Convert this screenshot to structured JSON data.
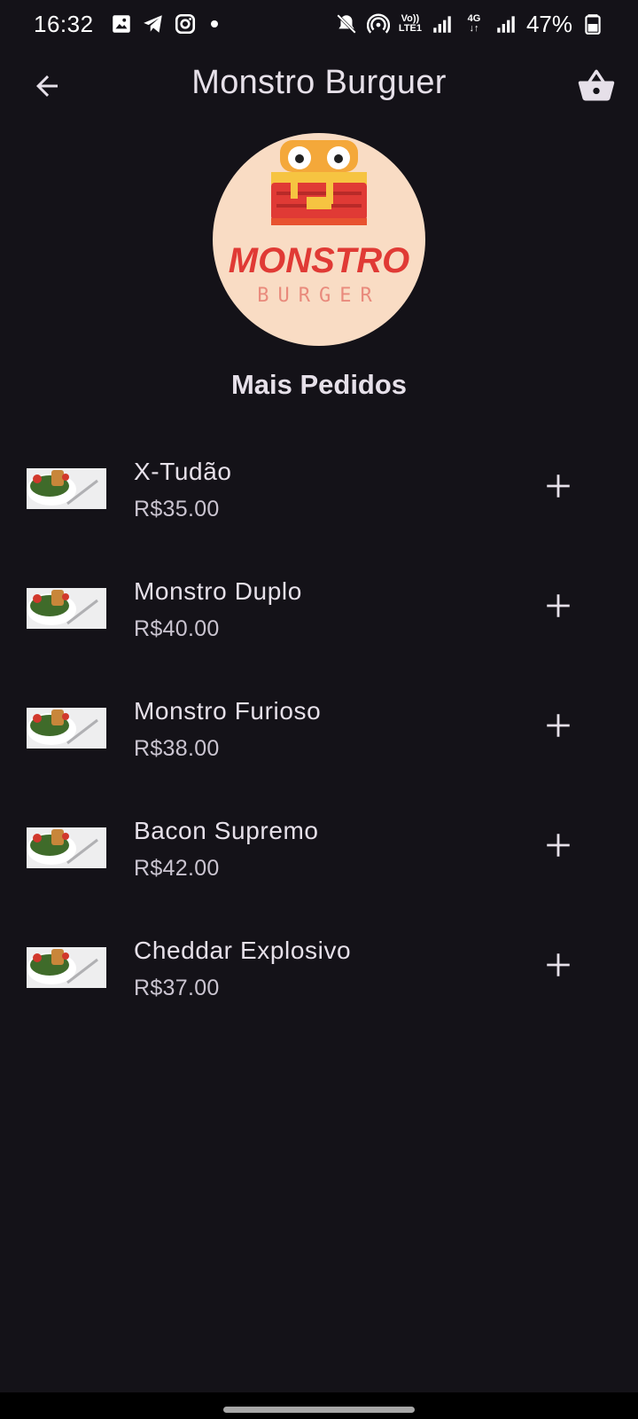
{
  "status_bar": {
    "time": "16:32",
    "battery": "47%",
    "volte": "Vo))",
    "lte": "LTE1",
    "net": "4G"
  },
  "app_bar": {
    "title": "Monstro Burguer"
  },
  "logo": {
    "main_text": "MONSTRO",
    "sub_text": "BURGER"
  },
  "section": {
    "title": "Mais Pedidos"
  },
  "menu": [
    {
      "name": "X-Tudão",
      "price": "R$35.00"
    },
    {
      "name": "Monstro Duplo",
      "price": "R$40.00"
    },
    {
      "name": "Monstro Furioso",
      "price": "R$38.00"
    },
    {
      "name": "Bacon Supremo",
      "price": "R$42.00"
    },
    {
      "name": "Cheddar Explosivo",
      "price": "R$37.00"
    }
  ],
  "icons": {
    "back": "arrow-back-icon",
    "cart": "shopping-basket-icon",
    "add": "plus-icon"
  },
  "colors": {
    "background": "#141218",
    "text": "#e6e0e9",
    "logo_bg": "#f9dcc4",
    "logo_red": "#e03a35"
  }
}
